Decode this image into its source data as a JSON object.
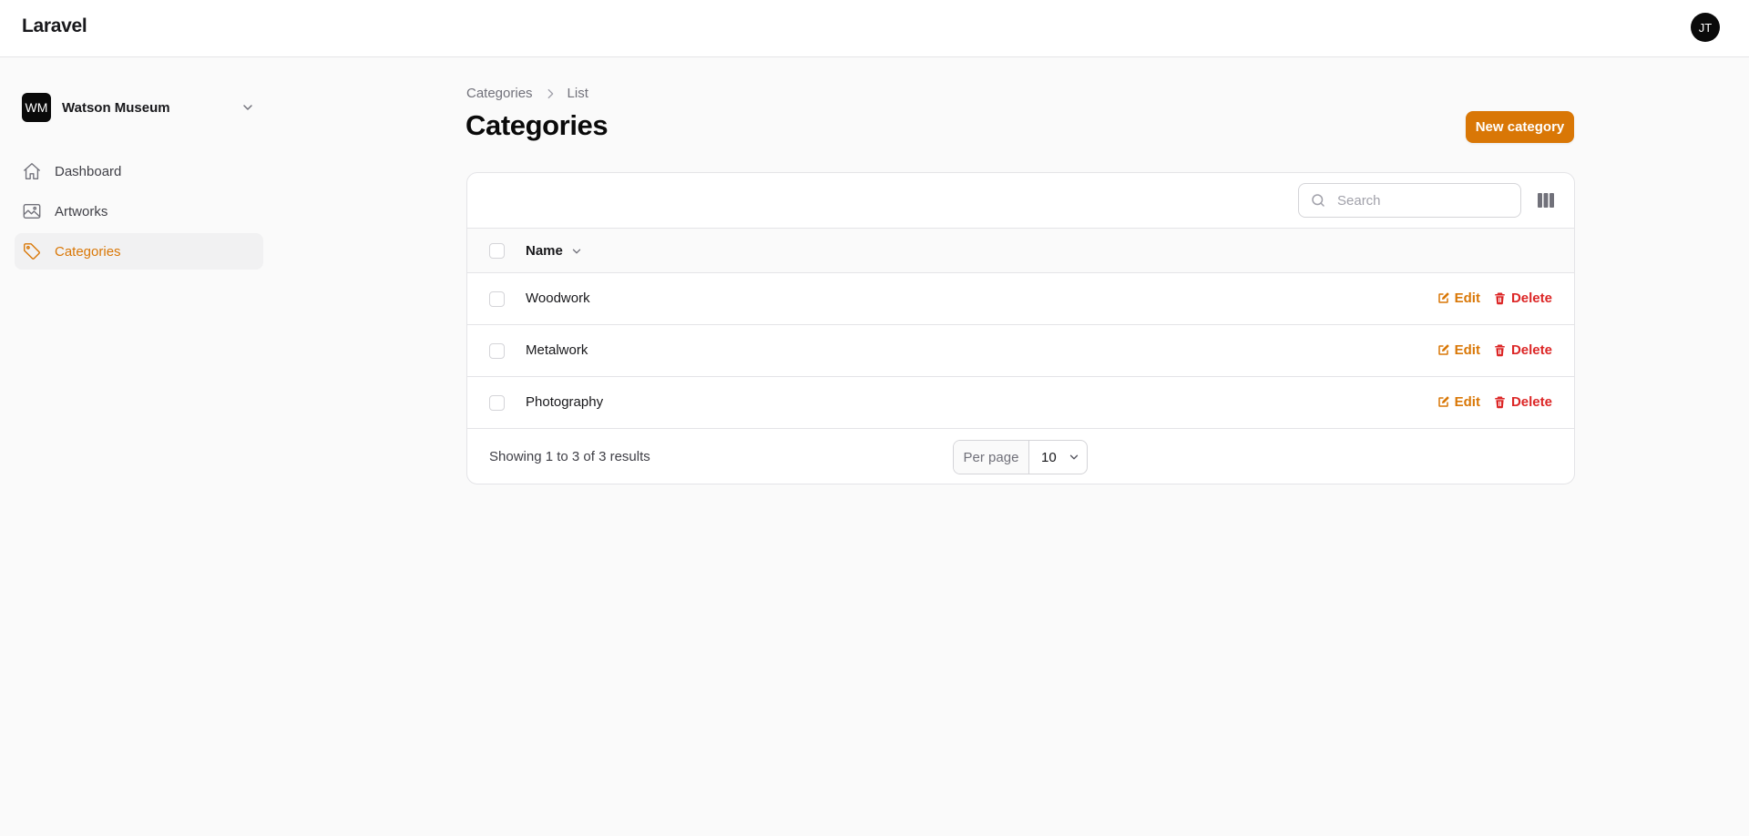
{
  "app": {
    "brand": "Laravel",
    "user_initials": "JT",
    "accent": "#d97706",
    "danger": "#dc2626"
  },
  "tenant": {
    "initials": "WM",
    "name": "Watson Museum"
  },
  "sidebar": {
    "items": [
      {
        "label": "Dashboard",
        "icon": "home-icon"
      },
      {
        "label": "Artworks",
        "icon": "image-icon"
      },
      {
        "label": "Categories",
        "icon": "tag-icon",
        "active": true
      }
    ]
  },
  "breadcrumb": {
    "parent": "Categories",
    "current": "List"
  },
  "page": {
    "title": "Categories",
    "new_button": "New category"
  },
  "table": {
    "search_placeholder": "Search",
    "column_name": "Name",
    "rows": [
      {
        "name": "Woodwork"
      },
      {
        "name": "Metalwork"
      },
      {
        "name": "Photography"
      }
    ],
    "edit_label": "Edit",
    "delete_label": "Delete",
    "results_text": "Showing 1 to 3 of 3 results",
    "per_page_label": "Per page",
    "per_page_value": "10"
  }
}
